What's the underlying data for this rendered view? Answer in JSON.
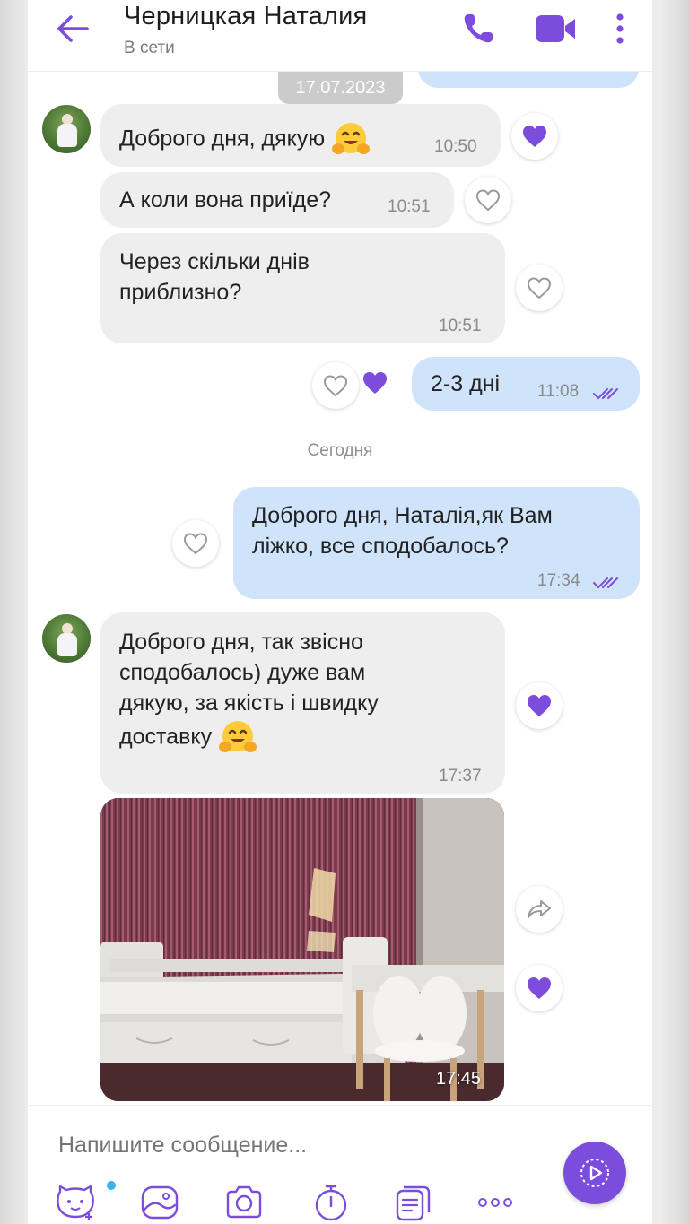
{
  "header": {
    "title": "Черницкая Наталия",
    "status": "В сети"
  },
  "chat": {
    "date_chip": "17.07.2023",
    "today_label": "Сегодня",
    "messages": [
      {
        "direction": "in",
        "text": "Доброго дня, дякую",
        "emoji": "hugging-face",
        "time": "10:50",
        "reaction": "liked"
      },
      {
        "direction": "in",
        "text": "А коли вона приїде?",
        "time": "10:51",
        "reaction": "none"
      },
      {
        "direction": "in",
        "text_lines": [
          "Через скільки днів",
          "приблизно?"
        ],
        "time": "10:51",
        "reaction": "none"
      },
      {
        "direction": "out",
        "text": "2-3 дні",
        "time": "11:08",
        "status": "read",
        "reaction": "liked"
      },
      {
        "direction": "out",
        "text_lines": [
          "Доброго дня, Наталія,як Вам",
          "ліжко, все сподобалось?"
        ],
        "time": "17:34",
        "status": "read",
        "reaction": "none"
      },
      {
        "direction": "in",
        "text_lines": [
          "Доброго дня, так звісно",
          "сподобалось) дуже вам",
          "дякую, за якість і швидку",
          "доставку"
        ],
        "emoji": "hugging-face",
        "time": "17:37",
        "reaction": "liked"
      },
      {
        "direction": "in",
        "type": "photo",
        "description": "bed",
        "time": "17:45",
        "reaction": "liked"
      }
    ]
  },
  "composer": {
    "placeholder": "Напишите сообщение...",
    "tools": [
      "sticker-icon",
      "gallery-icon",
      "camera-icon",
      "timer-icon",
      "gif-icon",
      "more-icon"
    ]
  },
  "colors": {
    "accent": "#7c4ddc",
    "incoming_bubble": "#eeeeee",
    "outgoing_bubble": "#cfe3fb"
  }
}
